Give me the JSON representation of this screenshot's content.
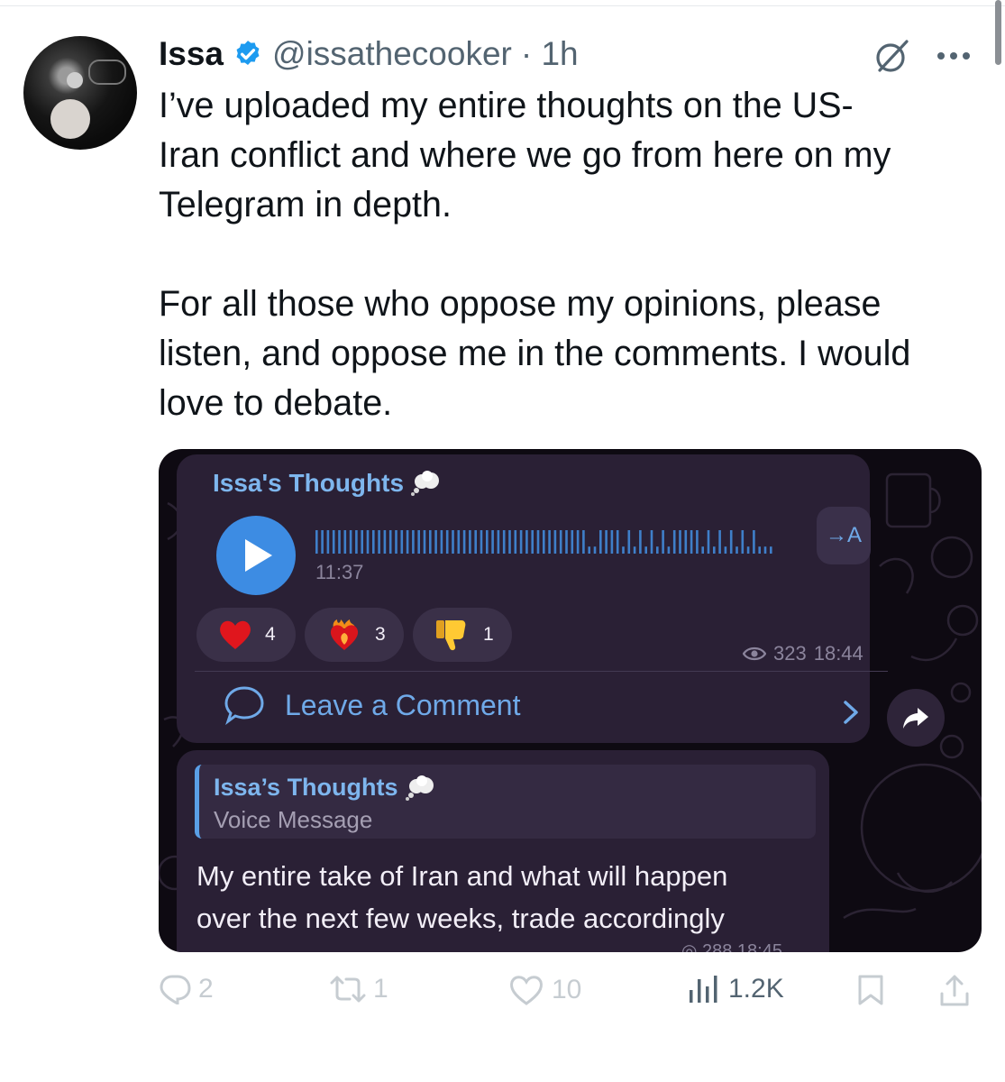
{
  "tweet": {
    "author_name": "Issa",
    "handle": "@issathecooker",
    "time": "· 1h",
    "text": "I’ve uploaded my entire thoughts on the US-\nIran conflict and where we go from here on my\nTelegram in depth.\n\nFor all those who oppose my opinions, please\nlisten, and oppose me in the comments. I would\nlove to debate.",
    "colors": {
      "verified": "#1d9bf0",
      "muted": "#536471"
    }
  },
  "telegram": {
    "channel_name": "Issa's Thoughts",
    "voice_duration": "11:37",
    "translate_label": "→A",
    "reactions": [
      {
        "icon": "heart",
        "count": "4"
      },
      {
        "icon": "heart-on-fire",
        "count": "3"
      },
      {
        "icon": "thumbs-down",
        "count": "1"
      }
    ],
    "views": "323",
    "post_time": "18:44",
    "comment_label": "Leave a Comment",
    "reply": {
      "channel_name": "Issa’s Thoughts",
      "subtitle": "Voice Message",
      "message": "My entire take of Iran and what will happen\nover the next few weeks, trade accordingly",
      "meta_partial": "◎ 288 18:45"
    },
    "colors": {
      "bubble": "#2a2035",
      "accent": "#6fa9e8",
      "play": "#3d8ce3"
    }
  },
  "actions": {
    "replies": "2",
    "reposts": "1",
    "likes": "10",
    "views": "1.2K"
  }
}
